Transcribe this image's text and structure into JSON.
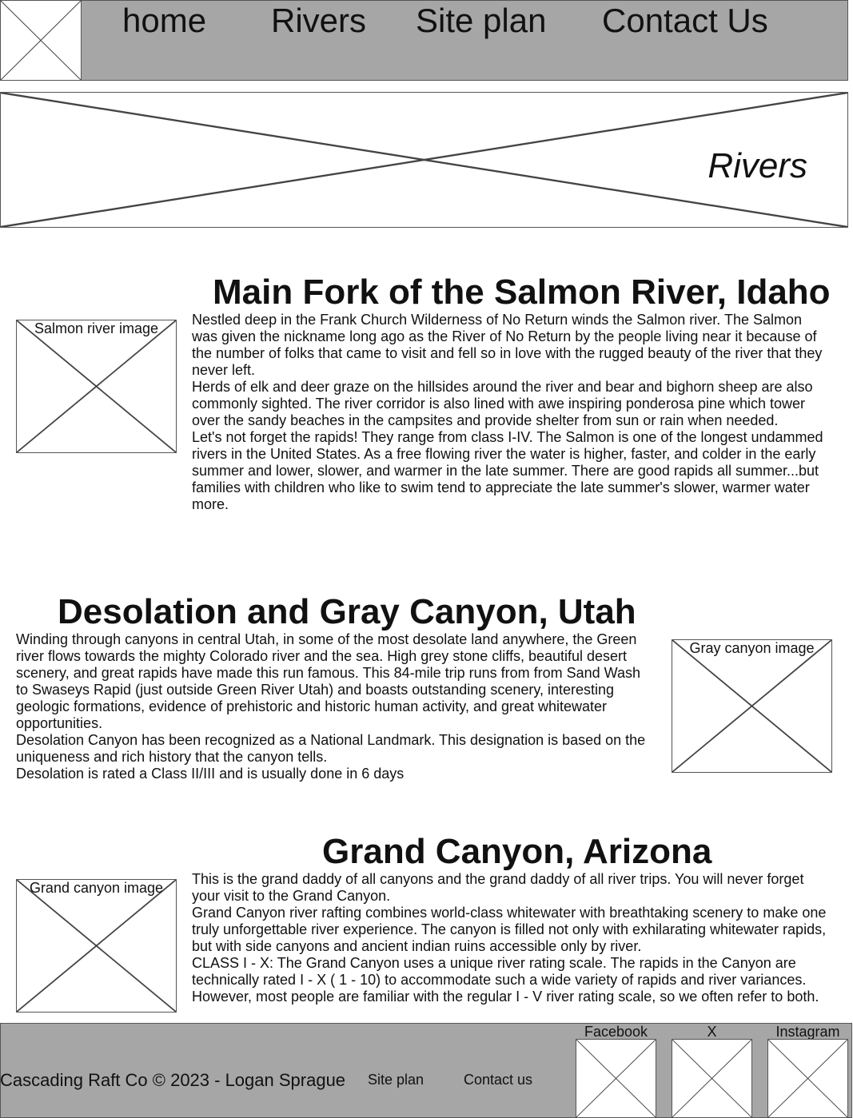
{
  "nav": {
    "items": [
      "home",
      "Rivers",
      "Site plan",
      "Contact Us"
    ]
  },
  "hero": {
    "title": "Rivers"
  },
  "sections": [
    {
      "heading": "Main Fork of the Salmon River, Idaho",
      "image_caption": "Salmon river image",
      "paragraphs": [
        "Nestled deep in the Frank Church Wilderness of No Return winds the Salmon river. The Salmon was given the nickname long ago as the River of No Return by the people living near it because of the number of folks that came to visit and fell so in love with the rugged beauty of the river that they never left.",
        "Herds of elk and deer graze on the hillsides around the river and bear and bighorn sheep are also commonly sighted. The river corridor is also lined with awe inspiring ponderosa pine which tower over the sandy beaches in the campsites and provide shelter from sun or rain when needed.",
        "Let's not forget the rapids! They range from class I-IV. The Salmon is one of the longest undammed rivers in the United States. As a free flowing river the water is higher, faster, and colder in the early summer and lower, slower, and warmer in the late summer. There are good rapids all summer...but families with children who like to swim tend to appreciate the late summer's slower, warmer water more."
      ]
    },
    {
      "heading": "Desolation and Gray Canyon, Utah",
      "image_caption": "Gray canyon image",
      "paragraphs": [
        "Winding through canyons in central Utah, in some of the most desolate land anywhere, the Green river flows towards the mighty Colorado river and the sea. High grey stone cliffs, beautiful desert scenery, and great rapids have made this run famous. This 84-mile trip runs from from Sand Wash to Swaseys Rapid (just outside Green River Utah) and boasts outstanding scenery, interesting geologic formations, evidence of prehistoric and historic human activity, and great whitewater opportunities.",
        "Desolation Canyon has been recognized as a National Landmark. This designation is based on the uniqueness and rich history that the canyon tells.",
        "Desolation is rated a Class II/III and is usually done in 6 days"
      ]
    },
    {
      "heading": "Grand Canyon, Arizona",
      "image_caption": "Grand canyon image",
      "paragraphs": [
        "This is the grand daddy of all canyons and the grand daddy of all river trips. You will never forget your visit to the Grand Canyon.",
        "Grand Canyon river rafting combines world-class whitewater with breathtaking scenery to make one truly unforgettable river experience. The canyon is filled not only with exhilarating whitewater rapids, but with side canyons and ancient indian ruins accessible only by river.",
        "CLASS I - X: The Grand Canyon uses a unique river rating scale. The rapids in the Canyon are technically rated I - X ( 1 - 10) to accommodate such a wide variety of rapids and river variances. However, most people are familiar with the regular I - V river rating scale, so we often refer to both."
      ]
    }
  ],
  "footer": {
    "copyright": "Cascading Raft Co © 2023 - Logan Sprague",
    "links": [
      "Site plan",
      "Contact us"
    ],
    "social": [
      "Facebook",
      "X",
      "Instagram"
    ]
  }
}
